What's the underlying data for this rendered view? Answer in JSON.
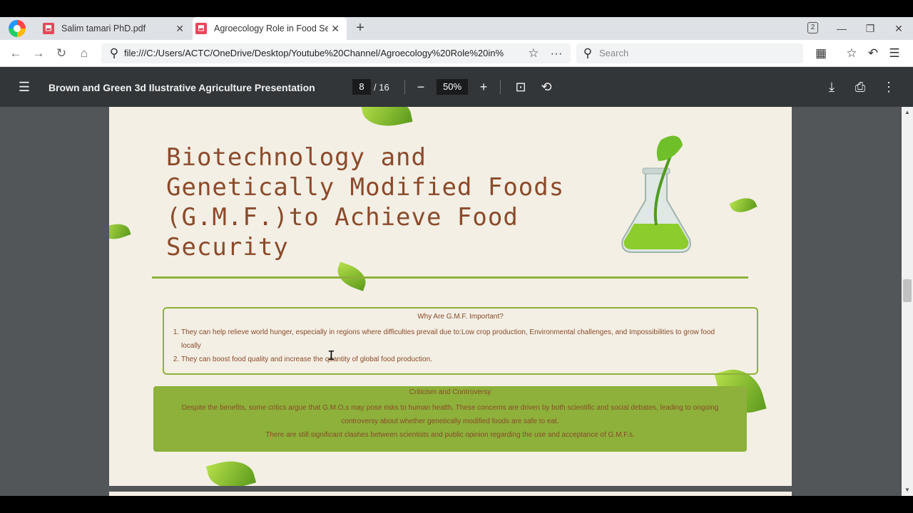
{
  "browser": {
    "tabs": [
      {
        "title": "Salim tamari PhD.pdf"
      },
      {
        "title": "Agroecology Role in Food Sec"
      }
    ],
    "tab_count": "2",
    "url": "file:///C:/Users/ACTC/OneDrive/Desktop/Youtube%20Channel/Agroecology%20Role%20in%",
    "search_placeholder": "Search"
  },
  "pdf_toolbar": {
    "title": "Brown and Green 3d Ilustrative Agriculture Presentation",
    "page_current": "8",
    "page_total": "/ 16",
    "zoom": "50%"
  },
  "slide": {
    "title": "Biotechnology and Genetically Modified Foods (G.M.F.)to Achieve Food Security",
    "box1": {
      "heading": "Why Are G.M.F. Important?",
      "items": [
        "They can help relieve world hunger, especially in regions where difficulties prevail due to:Low crop production, Environmental challenges, and Impossibilities to grow food locally",
        "They can boost food quality and increase the quantity of global food production."
      ]
    },
    "box2": {
      "heading": "Criticism and Controversy",
      "body1": "Despite the benefits, some critics argue that G.M.O.s may pose risks to human health. These concerns are driven by both scientific and social debates, leading to ongoing controversy about whether genetically modified foods are safe to eat.",
      "body2": "There are still significant clashes between scientists and public opinion regarding the use and acceptance of G.M.F.s."
    }
  },
  "colors": {
    "title_brown": "#8b4a2b",
    "accent_green": "#8db13a",
    "page_bg": "#f3efe4",
    "toolbar_bg": "#323639"
  }
}
